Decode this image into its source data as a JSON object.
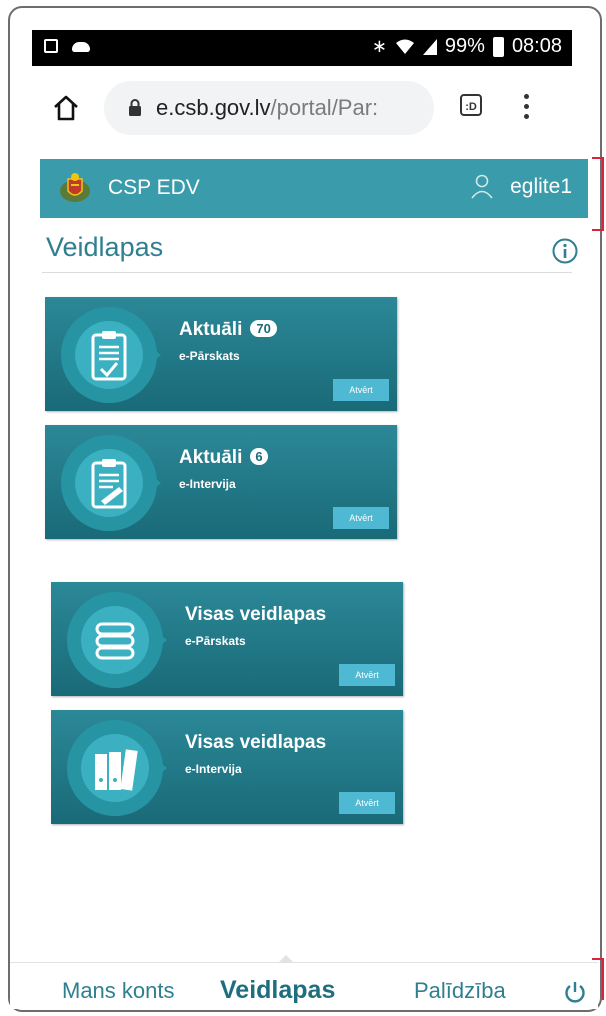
{
  "status_bar": {
    "left_icons": [
      "image-icon",
      "cloud-icon"
    ],
    "bluetooth": "∗",
    "wifi": "⌔",
    "battery": "99%",
    "time": "08:08"
  },
  "browser": {
    "url_host": "e.csb.gov.lv",
    "url_path": "/portal/Par:",
    "tabs_label": ":D"
  },
  "app": {
    "name": "CSP EDV",
    "username": "eglite1",
    "page_title": "Veidlapas"
  },
  "cards": [
    {
      "title": "Aktuāli",
      "badge": "70",
      "subtitle": "e-Pārskats",
      "button": "Atvērt",
      "icon": "clipboard-check-icon"
    },
    {
      "title": "Aktuāli",
      "badge": "6",
      "subtitle": "e-Intervija",
      "button": "Atvērt",
      "icon": "clipboard-pen-icon"
    },
    {
      "title": "Visas veidlapas",
      "subtitle": "e-Pārskats",
      "button": "Atvērt",
      "icon": "stacked-books-icon"
    },
    {
      "title": "Visas veidlapas",
      "subtitle": "e-Intervija",
      "button": "Atvērt",
      "icon": "binders-icon"
    }
  ],
  "bottom_nav": {
    "account": "Mans konts",
    "forms": "Veidlapas",
    "help": "Palīdzība"
  },
  "colors": {
    "header": "#3a9bab",
    "card": "#1a6a78",
    "button": "#4fb8d2",
    "accent": "#2f7f90"
  }
}
